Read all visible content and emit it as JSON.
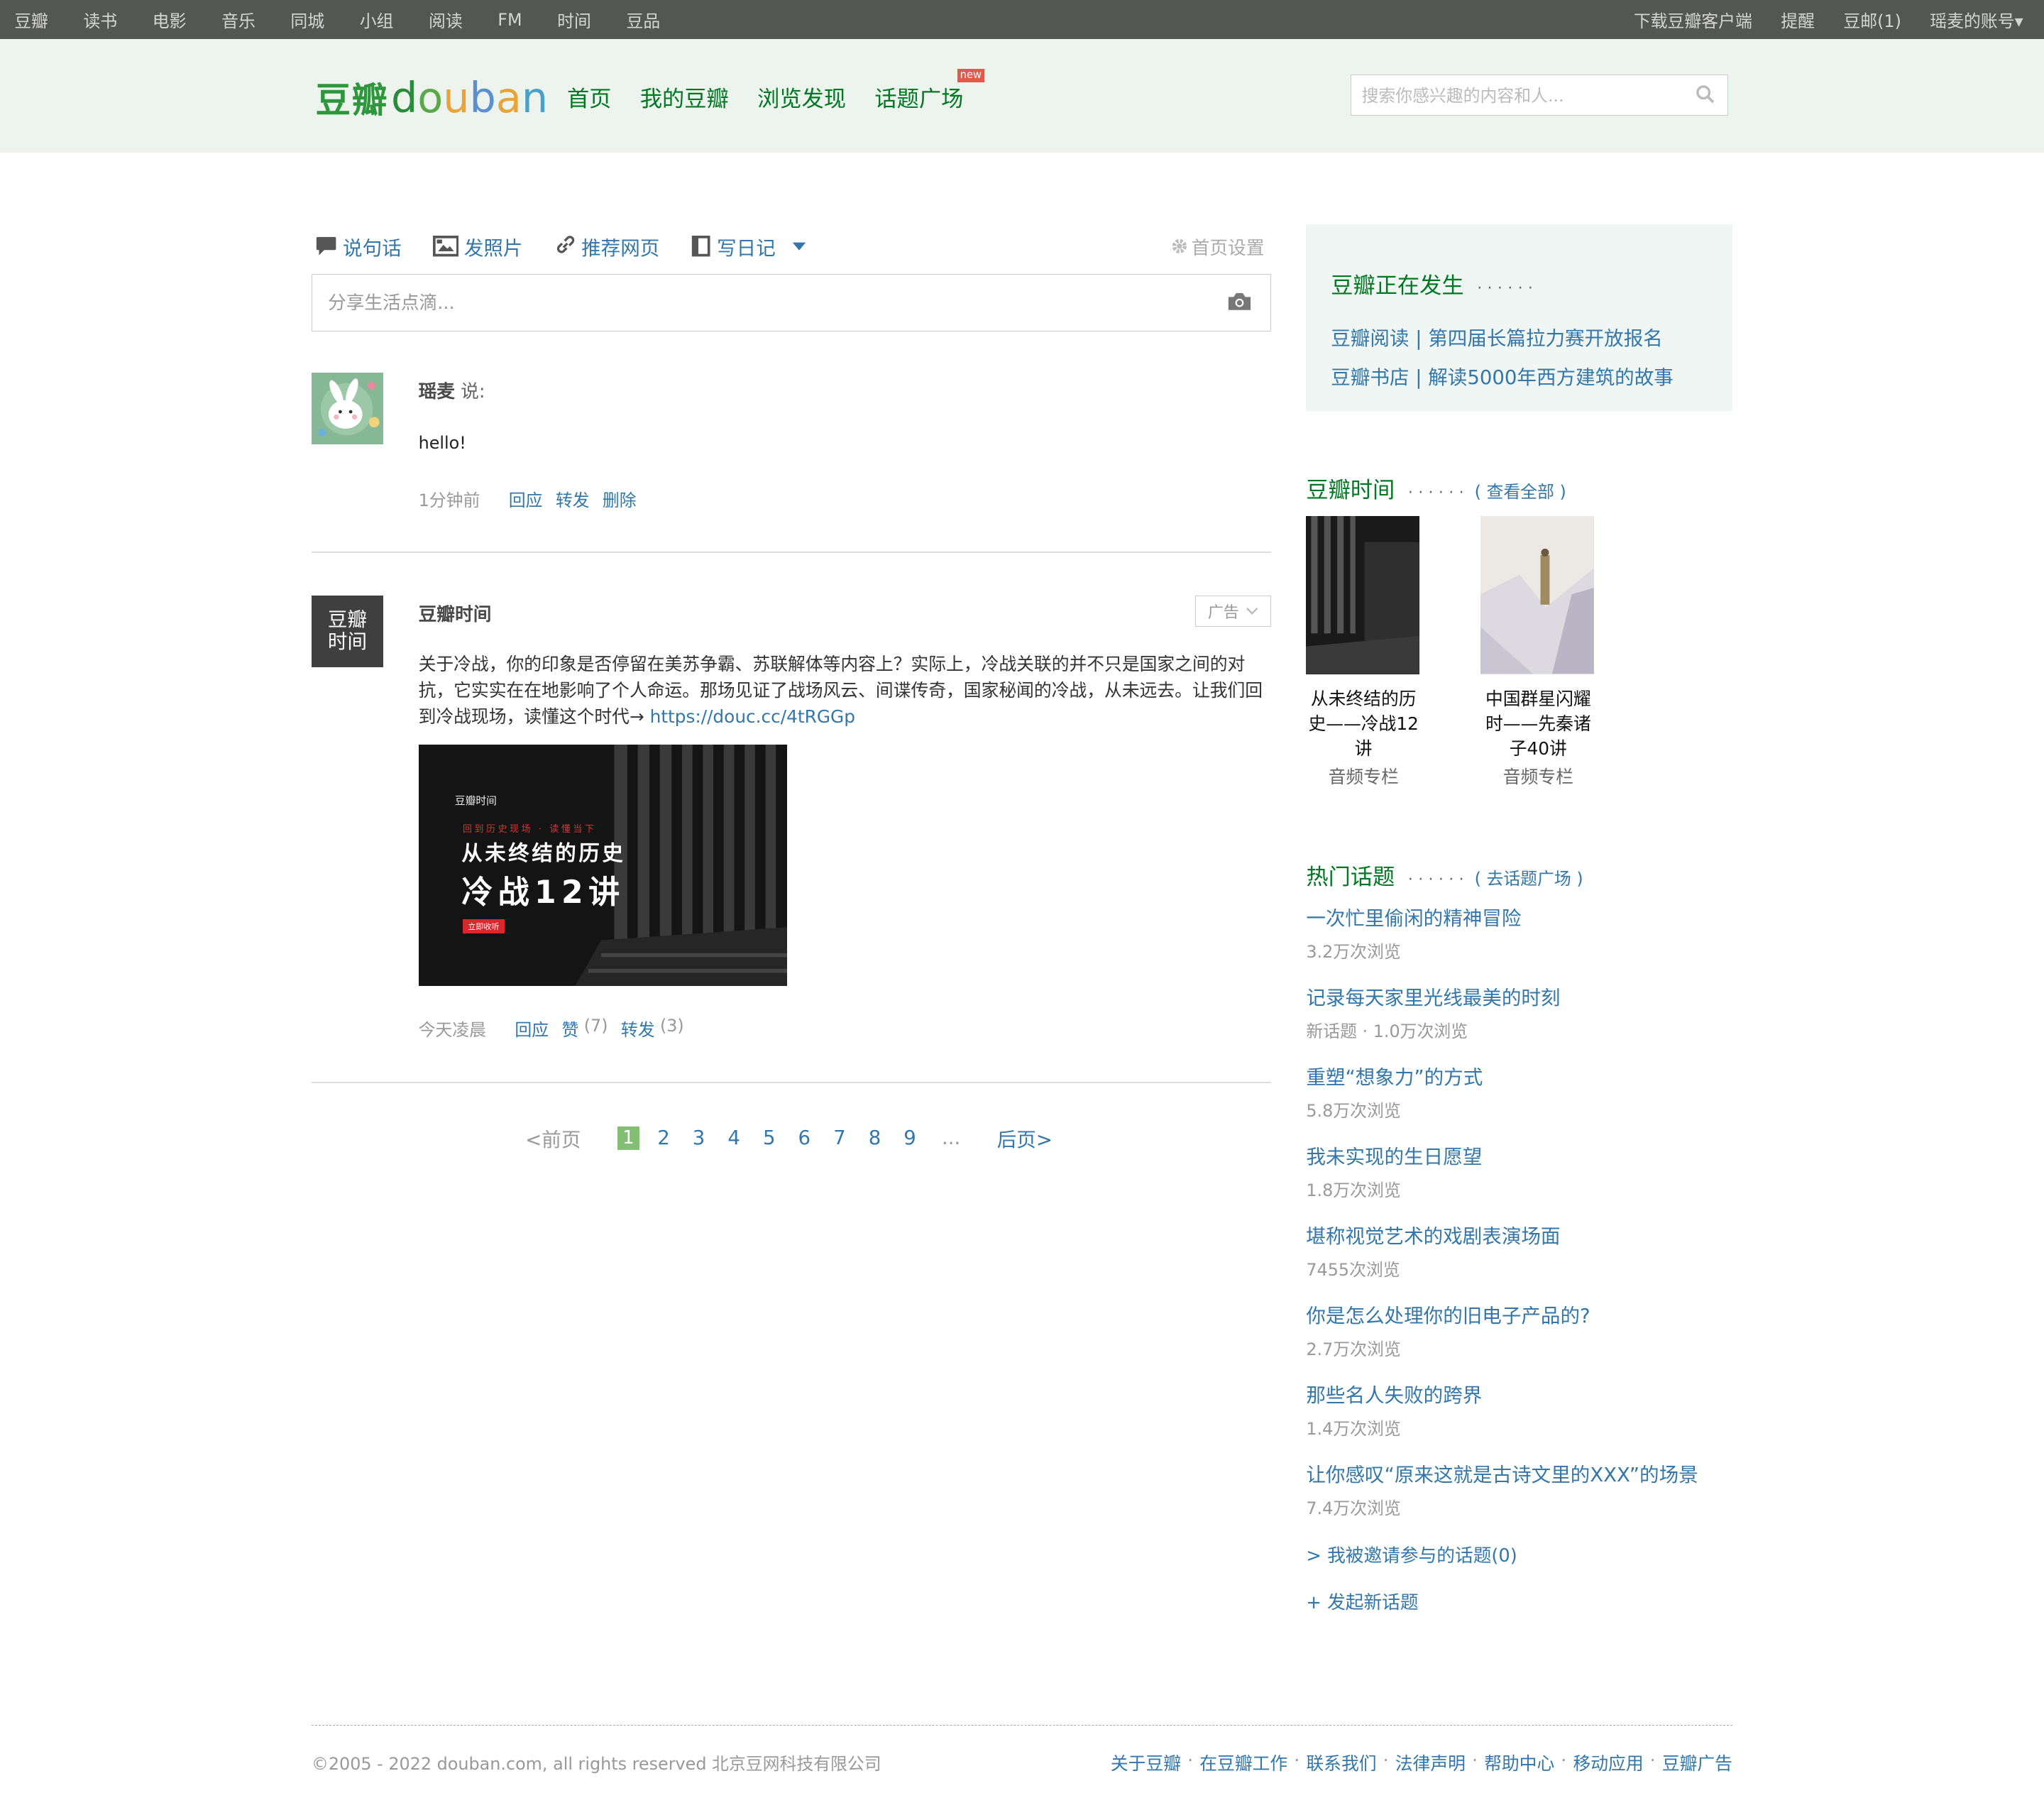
{
  "topnav": {
    "left": [
      "豆瓣",
      "读书",
      "电影",
      "音乐",
      "同城",
      "小组",
      "阅读",
      "FM",
      "时间",
      "豆品"
    ],
    "right": [
      "下载豆瓣客户端",
      "提醒",
      "豆邮(1)",
      "瑶麦的账号▾"
    ]
  },
  "header": {
    "logo_cn": "豆瓣",
    "logo_en": [
      "d",
      "o",
      "u",
      "b",
      "a",
      "n"
    ],
    "nav": [
      "首页",
      "我的豆瓣",
      "浏览发现",
      "话题广场"
    ],
    "new_badge": "new",
    "search_placeholder": "搜索你感兴趣的内容和人..."
  },
  "composer": {
    "tabs": [
      "说句话",
      "发照片",
      "推荐网页",
      "写日记"
    ],
    "home_settings": "首页设置",
    "share_placeholder": "分享生活点滴..."
  },
  "feed": [
    {
      "author": "瑶麦",
      "said": "说:",
      "text": "hello!",
      "time": "1分钟前",
      "actions": [
        "回应",
        "转发",
        "删除"
      ]
    },
    {
      "author": "豆瓣时间",
      "avatar_text": [
        "豆瓣",
        "时间"
      ],
      "ad_label": "广告",
      "text": "关于冷战，你的印象是否停留在美苏争霸、苏联解体等内容上？实际上，冷战关联的并不只是国家之间的对抗，它实实在在地影响了个人命运。那场见证了战场风云、间谍传奇，国家秘闻的冷战，从未远去。让我们回到冷战现场，读懂这个时代→ ",
      "link": "https://douc.cc/4tRGGp",
      "image": {
        "brand": "豆瓣时间",
        "tagline": "回到历史现场 · 读懂当下",
        "title1": "从未终结的历史",
        "title2": "冷战12讲",
        "button": "立即收听"
      },
      "time": "今天凌晨",
      "reply": "回应",
      "like": "赞",
      "like_count": "(7)",
      "forward": "转发",
      "forward_count": "(3)"
    }
  ],
  "pager": {
    "prev": "<前页",
    "pages": [
      "1",
      "2",
      "3",
      "4",
      "5",
      "6",
      "7",
      "8",
      "9"
    ],
    "current": "1",
    "dots": "...",
    "next": "后页>"
  },
  "sidebar": {
    "happening": {
      "title": "豆瓣正在发生",
      "dots": "······",
      "links": [
        "豆瓣阅读 | 第四届长篇拉力赛开放报名",
        "豆瓣书店 | 解读5000年西方建筑的故事"
      ]
    },
    "time": {
      "title": "豆瓣时间",
      "dots": "······",
      "more": "( 查看全部 )",
      "items": [
        {
          "title": "从未终结的历史——冷战12讲",
          "type": "音频专栏"
        },
        {
          "title": "中国群星闪耀时——先秦诸子40讲",
          "type": "音频专栏"
        }
      ]
    },
    "topics": {
      "title": "热门话题",
      "dots": "······",
      "more": "( 去话题广场 )",
      "items": [
        {
          "title": "一次忙里偷闲的精神冒险",
          "meta": "3.2万次浏览"
        },
        {
          "title": "记录每天家里光线最美的时刻",
          "meta": "新话题 · 1.0万次浏览"
        },
        {
          "title": "重塑“想象力”的方式",
          "meta": "5.8万次浏览"
        },
        {
          "title": "我未实现的生日愿望",
          "meta": "1.8万次浏览"
        },
        {
          "title": "堪称视觉艺术的戏剧表演场面",
          "meta": "7455次浏览"
        },
        {
          "title": "你是怎么处理你的旧电子产品的?",
          "meta": "2.7万次浏览"
        },
        {
          "title": "那些名人失败的跨界",
          "meta": "1.4万次浏览"
        },
        {
          "title": "让你感叹“原来这就是古诗文里的XXX”的场景",
          "meta": "7.4万次浏览"
        }
      ],
      "invited": "> 我被邀请参与的话题(0)",
      "new_topic": "+ 发起新话题"
    }
  },
  "footer": {
    "copyright": "©2005 - 2022 douban.com, all rights reserved 北京豆网科技有限公司",
    "links": [
      "关于豆瓣",
      "在豆瓣工作",
      "联系我们",
      "法律声明",
      "帮助中心",
      "移动应用",
      "豆瓣广告"
    ]
  },
  "colors": {
    "topbar": "#545652",
    "header_bg": "#edf4ed",
    "brand_green": "#2e963d",
    "nav_green": "#007722",
    "link_blue": "#3377aa",
    "pager_current": "#83bf73"
  }
}
